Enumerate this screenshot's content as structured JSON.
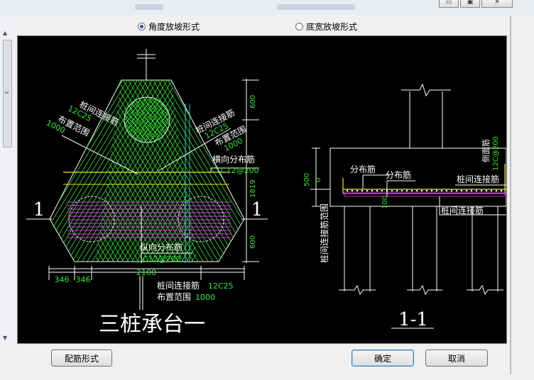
{
  "window": {
    "minimize_glyph": "▭",
    "restore_glyph": "▣",
    "close_glyph": "✕"
  },
  "options": {
    "angle_slope": "角度放坡形式",
    "bottom_width_slope": "底宽放坡形式",
    "selected": "angle_slope"
  },
  "plan": {
    "section_marker_left": "1",
    "section_marker_right": "1",
    "dim_600_top": "600",
    "dim_1819": "1819",
    "dim_600_bottom": "600",
    "dim_2100": "2100",
    "dim_346_a": "346",
    "dim_346_b": "346",
    "left_label_title": "桩间连接筋",
    "left_label_spec": "12C25",
    "left_label_range_title": "布置范围",
    "left_label_range_value": "1000",
    "right_label_title": "桩间连接筋",
    "right_label_spec": "12C25",
    "right_label_range_title": "布置范围",
    "right_label_range_value": "1000",
    "horizontal_dist_title": "横向分布筋",
    "horizontal_dist_spec": "C12@200",
    "vertical_dist_title": "纵向分布筋",
    "vertical_dist_spec": "C12@200",
    "bottom_label_title": "桩间连接筋",
    "bottom_label_spec": "12C25",
    "bottom_label_range_title": "布置范围",
    "bottom_label_range_value": "1000",
    "caption": "三桩承台一"
  },
  "section": {
    "dim_500": "500",
    "dim_0": "0",
    "dim_100": "100",
    "label_dist_1": "分布筋",
    "label_dist_2": "分布筋",
    "label_connect_1": "桩间连接筋",
    "label_connect_2": "桩间连接筋",
    "label_side": "侧面筋",
    "label_side_spec": "12C@200",
    "label_range": "桩间连接筋范围",
    "caption": "1-1"
  },
  "buttons": {
    "rebar_form": "配筋形式",
    "ok": "确定",
    "cancel": "取消"
  },
  "colors": {
    "background": "#000000",
    "drawing_white": "#ffffff",
    "rebar_green": "#33e633",
    "distribution_magenta": "#e040e0",
    "yellow": "#e8e820",
    "cyan": "#30d8d8",
    "selected_radio": "#1d56b8"
  }
}
